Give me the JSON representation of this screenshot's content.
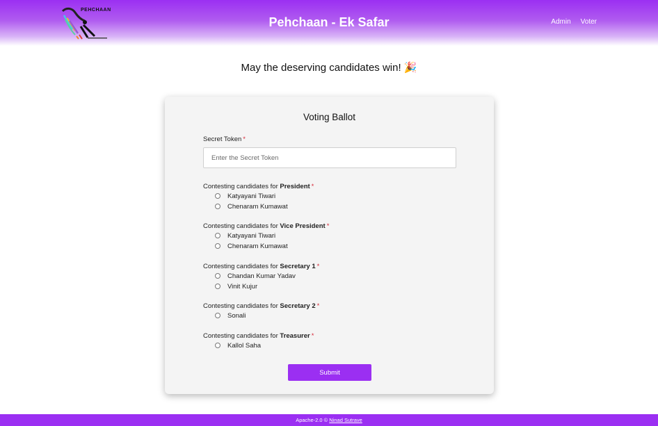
{
  "header": {
    "logo_text": "PEHCHAAN",
    "title": "Pehchaan - Ek Safar",
    "nav": [
      "Admin",
      "Voter"
    ]
  },
  "tagline": "May the deserving candidates win! 🎉",
  "ballot": {
    "title": "Voting Ballot",
    "token_label": "Secret Token",
    "required_mark": "*",
    "token_placeholder": "Enter the Secret Token",
    "prefix": "Contesting candidates for",
    "groups": [
      {
        "position": "President",
        "candidates": [
          "Katyayani Tiwari",
          "Chenaram Kumawat"
        ]
      },
      {
        "position": "Vice President",
        "candidates": [
          "Katyayani Tiwari",
          "Chenaram Kumawat"
        ]
      },
      {
        "position": "Secretary 1",
        "candidates": [
          "Chandan Kumar Yadav",
          "Vinit Kujur"
        ]
      },
      {
        "position": "Secretary 2",
        "candidates": [
          "Sonali"
        ]
      },
      {
        "position": "Treasurer",
        "candidates": [
          "Kallol Saha"
        ]
      }
    ],
    "submit_label": "Submit"
  },
  "footer": {
    "license": "Apache-2.0 ©",
    "author": "Ninad Sutrave"
  },
  "colors": {
    "accent": "#9b2ff2",
    "card": "#f4f4f4",
    "required": "#d62b3a"
  }
}
